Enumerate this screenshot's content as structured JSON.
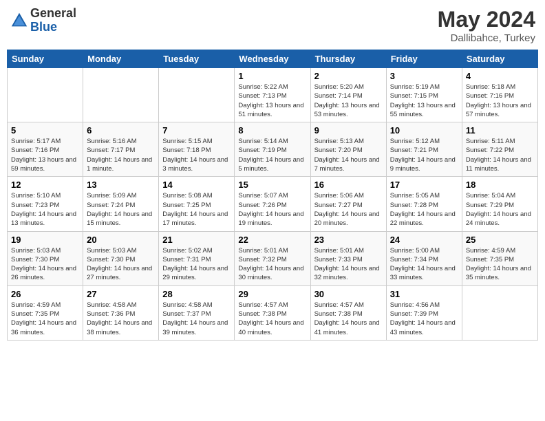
{
  "header": {
    "logo_general": "General",
    "logo_blue": "Blue",
    "month_year": "May 2024",
    "location": "Dallibahce, Turkey"
  },
  "weekdays": [
    "Sunday",
    "Monday",
    "Tuesday",
    "Wednesday",
    "Thursday",
    "Friday",
    "Saturday"
  ],
  "weeks": [
    [
      {
        "day": "",
        "sunrise": "",
        "sunset": "",
        "daylight": ""
      },
      {
        "day": "",
        "sunrise": "",
        "sunset": "",
        "daylight": ""
      },
      {
        "day": "",
        "sunrise": "",
        "sunset": "",
        "daylight": ""
      },
      {
        "day": "1",
        "sunrise": "Sunrise: 5:22 AM",
        "sunset": "Sunset: 7:13 PM",
        "daylight": "Daylight: 13 hours and 51 minutes."
      },
      {
        "day": "2",
        "sunrise": "Sunrise: 5:20 AM",
        "sunset": "Sunset: 7:14 PM",
        "daylight": "Daylight: 13 hours and 53 minutes."
      },
      {
        "day": "3",
        "sunrise": "Sunrise: 5:19 AM",
        "sunset": "Sunset: 7:15 PM",
        "daylight": "Daylight: 13 hours and 55 minutes."
      },
      {
        "day": "4",
        "sunrise": "Sunrise: 5:18 AM",
        "sunset": "Sunset: 7:16 PM",
        "daylight": "Daylight: 13 hours and 57 minutes."
      }
    ],
    [
      {
        "day": "5",
        "sunrise": "Sunrise: 5:17 AM",
        "sunset": "Sunset: 7:16 PM",
        "daylight": "Daylight: 13 hours and 59 minutes."
      },
      {
        "day": "6",
        "sunrise": "Sunrise: 5:16 AM",
        "sunset": "Sunset: 7:17 PM",
        "daylight": "Daylight: 14 hours and 1 minute."
      },
      {
        "day": "7",
        "sunrise": "Sunrise: 5:15 AM",
        "sunset": "Sunset: 7:18 PM",
        "daylight": "Daylight: 14 hours and 3 minutes."
      },
      {
        "day": "8",
        "sunrise": "Sunrise: 5:14 AM",
        "sunset": "Sunset: 7:19 PM",
        "daylight": "Daylight: 14 hours and 5 minutes."
      },
      {
        "day": "9",
        "sunrise": "Sunrise: 5:13 AM",
        "sunset": "Sunset: 7:20 PM",
        "daylight": "Daylight: 14 hours and 7 minutes."
      },
      {
        "day": "10",
        "sunrise": "Sunrise: 5:12 AM",
        "sunset": "Sunset: 7:21 PM",
        "daylight": "Daylight: 14 hours and 9 minutes."
      },
      {
        "day": "11",
        "sunrise": "Sunrise: 5:11 AM",
        "sunset": "Sunset: 7:22 PM",
        "daylight": "Daylight: 14 hours and 11 minutes."
      }
    ],
    [
      {
        "day": "12",
        "sunrise": "Sunrise: 5:10 AM",
        "sunset": "Sunset: 7:23 PM",
        "daylight": "Daylight: 14 hours and 13 minutes."
      },
      {
        "day": "13",
        "sunrise": "Sunrise: 5:09 AM",
        "sunset": "Sunset: 7:24 PM",
        "daylight": "Daylight: 14 hours and 15 minutes."
      },
      {
        "day": "14",
        "sunrise": "Sunrise: 5:08 AM",
        "sunset": "Sunset: 7:25 PM",
        "daylight": "Daylight: 14 hours and 17 minutes."
      },
      {
        "day": "15",
        "sunrise": "Sunrise: 5:07 AM",
        "sunset": "Sunset: 7:26 PM",
        "daylight": "Daylight: 14 hours and 19 minutes."
      },
      {
        "day": "16",
        "sunrise": "Sunrise: 5:06 AM",
        "sunset": "Sunset: 7:27 PM",
        "daylight": "Daylight: 14 hours and 20 minutes."
      },
      {
        "day": "17",
        "sunrise": "Sunrise: 5:05 AM",
        "sunset": "Sunset: 7:28 PM",
        "daylight": "Daylight: 14 hours and 22 minutes."
      },
      {
        "day": "18",
        "sunrise": "Sunrise: 5:04 AM",
        "sunset": "Sunset: 7:29 PM",
        "daylight": "Daylight: 14 hours and 24 minutes."
      }
    ],
    [
      {
        "day": "19",
        "sunrise": "Sunrise: 5:03 AM",
        "sunset": "Sunset: 7:30 PM",
        "daylight": "Daylight: 14 hours and 26 minutes."
      },
      {
        "day": "20",
        "sunrise": "Sunrise: 5:03 AM",
        "sunset": "Sunset: 7:30 PM",
        "daylight": "Daylight: 14 hours and 27 minutes."
      },
      {
        "day": "21",
        "sunrise": "Sunrise: 5:02 AM",
        "sunset": "Sunset: 7:31 PM",
        "daylight": "Daylight: 14 hours and 29 minutes."
      },
      {
        "day": "22",
        "sunrise": "Sunrise: 5:01 AM",
        "sunset": "Sunset: 7:32 PM",
        "daylight": "Daylight: 14 hours and 30 minutes."
      },
      {
        "day": "23",
        "sunrise": "Sunrise: 5:01 AM",
        "sunset": "Sunset: 7:33 PM",
        "daylight": "Daylight: 14 hours and 32 minutes."
      },
      {
        "day": "24",
        "sunrise": "Sunrise: 5:00 AM",
        "sunset": "Sunset: 7:34 PM",
        "daylight": "Daylight: 14 hours and 33 minutes."
      },
      {
        "day": "25",
        "sunrise": "Sunrise: 4:59 AM",
        "sunset": "Sunset: 7:35 PM",
        "daylight": "Daylight: 14 hours and 35 minutes."
      }
    ],
    [
      {
        "day": "26",
        "sunrise": "Sunrise: 4:59 AM",
        "sunset": "Sunset: 7:35 PM",
        "daylight": "Daylight: 14 hours and 36 minutes."
      },
      {
        "day": "27",
        "sunrise": "Sunrise: 4:58 AM",
        "sunset": "Sunset: 7:36 PM",
        "daylight": "Daylight: 14 hours and 38 minutes."
      },
      {
        "day": "28",
        "sunrise": "Sunrise: 4:58 AM",
        "sunset": "Sunset: 7:37 PM",
        "daylight": "Daylight: 14 hours and 39 minutes."
      },
      {
        "day": "29",
        "sunrise": "Sunrise: 4:57 AM",
        "sunset": "Sunset: 7:38 PM",
        "daylight": "Daylight: 14 hours and 40 minutes."
      },
      {
        "day": "30",
        "sunrise": "Sunrise: 4:57 AM",
        "sunset": "Sunset: 7:38 PM",
        "daylight": "Daylight: 14 hours and 41 minutes."
      },
      {
        "day": "31",
        "sunrise": "Sunrise: 4:56 AM",
        "sunset": "Sunset: 7:39 PM",
        "daylight": "Daylight: 14 hours and 43 minutes."
      },
      {
        "day": "",
        "sunrise": "",
        "sunset": "",
        "daylight": ""
      }
    ]
  ]
}
